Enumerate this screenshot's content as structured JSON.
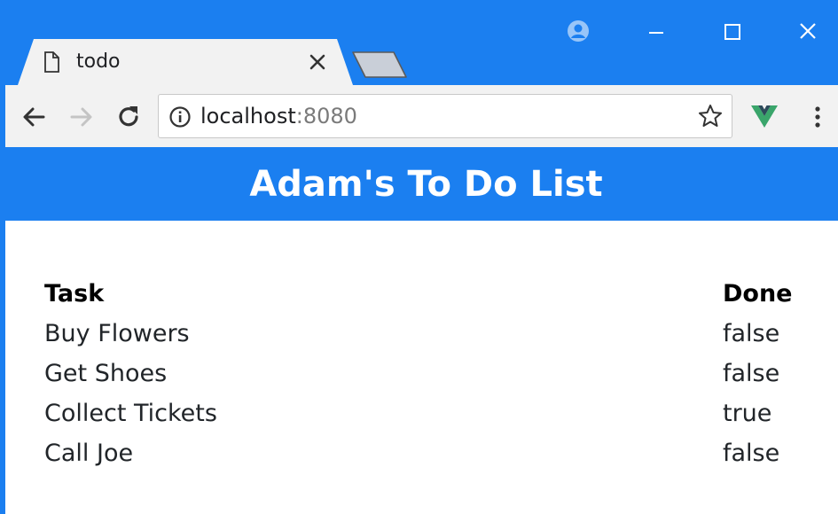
{
  "browser": {
    "tab": {
      "title": "todo",
      "favicon": "page-icon"
    },
    "address_bar": {
      "host": "localhost",
      "port": ":8080"
    },
    "icons": {
      "back": "arrow-left-icon",
      "forward": "arrow-right-icon",
      "reload": "reload-icon",
      "info": "info-icon",
      "bookmark": "star-icon",
      "extension": "vue-devtools-icon",
      "menu": "kebab-menu-icon",
      "profile": "profile-icon"
    },
    "colors": {
      "chrome_blue": "#1b7ff0",
      "toolbar": "#f2f2f2",
      "vue_green": "#3aa56b"
    }
  },
  "app": {
    "title": "Adam's To Do List",
    "table": {
      "headers": {
        "task": "Task",
        "done": "Done"
      },
      "rows": [
        {
          "task": "Buy Flowers",
          "done": "false"
        },
        {
          "task": "Get Shoes",
          "done": "false"
        },
        {
          "task": "Collect Tickets",
          "done": "true"
        },
        {
          "task": "Call Joe",
          "done": "false"
        }
      ]
    },
    "colors": {
      "header_bg": "#1b7ff0",
      "header_text": "#ffffff"
    }
  }
}
